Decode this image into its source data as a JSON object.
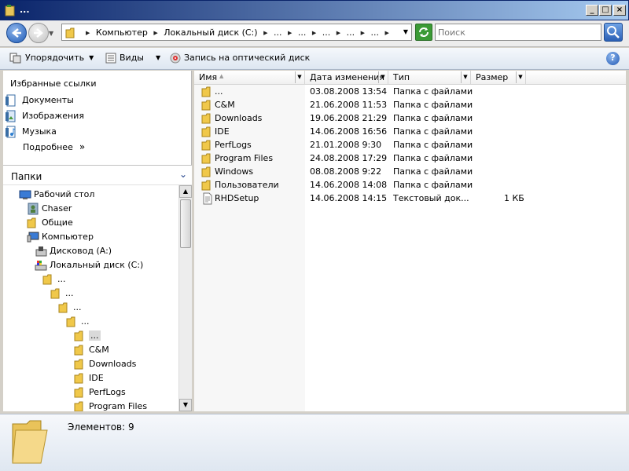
{
  "window": {
    "title": "..."
  },
  "address": {
    "crumbs": [
      "Компьютер",
      "Локальный диск (C:)",
      "...",
      "...",
      "...",
      "...",
      "..."
    ],
    "search_placeholder": "Поиск"
  },
  "toolbar": {
    "organize": "Упорядочить",
    "views": "Виды",
    "burn": "Запись на оптический диск",
    "help": "?"
  },
  "favorites": {
    "title": "Избранные ссылки",
    "items": [
      {
        "label": "Документы",
        "icon": "documents-icon"
      },
      {
        "label": "Изображения",
        "icon": "pictures-icon"
      },
      {
        "label": "Музыка",
        "icon": "music-icon"
      }
    ],
    "more": "Подробнее"
  },
  "folders": {
    "title": "Папки",
    "tree": [
      {
        "label": "Рабочий стол",
        "icon": "desktop-icon",
        "level": 0
      },
      {
        "label": "Chaser",
        "icon": "user-folder-icon",
        "level": 1
      },
      {
        "label": "Общие",
        "icon": "folder-icon",
        "level": 1
      },
      {
        "label": "Компьютер",
        "icon": "computer-icon",
        "level": 1
      },
      {
        "label": "Дисковод (A:)",
        "icon": "floppy-icon",
        "level": 2
      },
      {
        "label": "Локальный диск (C:)",
        "icon": "drive-icon",
        "level": 2
      },
      {
        "label": "...",
        "icon": "folder-icon",
        "level": 3
      },
      {
        "label": "...",
        "icon": "folder-icon",
        "level": 4
      },
      {
        "label": "...",
        "icon": "folder-icon",
        "level": 5
      },
      {
        "label": "...",
        "icon": "folder-icon",
        "level": 6
      },
      {
        "label": "...",
        "icon": "folder-icon",
        "level": 7,
        "selected": true
      },
      {
        "label": "C&M",
        "icon": "folder-icon",
        "level": 7
      },
      {
        "label": "Downloads",
        "icon": "folder-icon",
        "level": 7
      },
      {
        "label": "IDE",
        "icon": "folder-icon",
        "level": 7
      },
      {
        "label": "PerfLogs",
        "icon": "folder-icon",
        "level": 7
      },
      {
        "label": "Program Files",
        "icon": "folder-icon",
        "level": 7
      }
    ]
  },
  "columns": {
    "name": "Имя",
    "date": "Дата изменения",
    "type": "Тип",
    "size": "Размер"
  },
  "files": [
    {
      "name": "...",
      "date": "03.08.2008 13:54",
      "type": "Папка с файлами",
      "size": "",
      "icon": "folder-icon"
    },
    {
      "name": "C&M",
      "date": "21.06.2008 11:53",
      "type": "Папка с файлами",
      "size": "",
      "icon": "folder-icon"
    },
    {
      "name": "Downloads",
      "date": "19.06.2008 21:29",
      "type": "Папка с файлами",
      "size": "",
      "icon": "folder-icon"
    },
    {
      "name": "IDE",
      "date": "14.06.2008 16:56",
      "type": "Папка с файлами",
      "size": "",
      "icon": "folder-icon"
    },
    {
      "name": "PerfLogs",
      "date": "21.01.2008 9:30",
      "type": "Папка с файлами",
      "size": "",
      "icon": "folder-icon"
    },
    {
      "name": "Program Files",
      "date": "24.08.2008 17:29",
      "type": "Папка с файлами",
      "size": "",
      "icon": "folder-icon"
    },
    {
      "name": "Windows",
      "date": "08.08.2008 9:22",
      "type": "Папка с файлами",
      "size": "",
      "icon": "folder-icon"
    },
    {
      "name": "Пользователи",
      "date": "14.06.2008 14:08",
      "type": "Папка с файлами",
      "size": "",
      "icon": "folder-icon"
    },
    {
      "name": "RHDSetup",
      "date": "14.06.2008 14:15",
      "type": "Текстовый док...",
      "size": "1 КБ",
      "icon": "text-file-icon"
    }
  ],
  "status": {
    "items_count": "Элементов: 9"
  }
}
